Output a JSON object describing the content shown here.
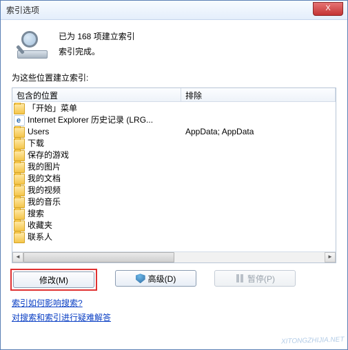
{
  "window": {
    "title": "索引选项",
    "close_label": "X"
  },
  "status": {
    "line1": "已为 168 项建立索引",
    "line2": "索引完成。"
  },
  "section_label": "为这些位置建立索引:",
  "columns": {
    "included": "包含的位置",
    "excluded": "排除"
  },
  "rows": [
    {
      "icon": "folder",
      "name": "「开始」菜单",
      "exclude": ""
    },
    {
      "icon": "ie",
      "name": "Internet Explorer 历史记录 (LRG...",
      "exclude": ""
    },
    {
      "icon": "folder",
      "name": "Users",
      "exclude": "AppData; AppData"
    },
    {
      "icon": "folder",
      "name": "下载",
      "exclude": ""
    },
    {
      "icon": "folder",
      "name": "保存的游戏",
      "exclude": ""
    },
    {
      "icon": "folder",
      "name": "我的图片",
      "exclude": ""
    },
    {
      "icon": "folder",
      "name": "我的文档",
      "exclude": ""
    },
    {
      "icon": "folder",
      "name": "我的视频",
      "exclude": ""
    },
    {
      "icon": "folder",
      "name": "我的音乐",
      "exclude": ""
    },
    {
      "icon": "folder",
      "name": "搜索",
      "exclude": ""
    },
    {
      "icon": "folder",
      "name": "收藏夹",
      "exclude": ""
    },
    {
      "icon": "folder",
      "name": "联系人",
      "exclude": ""
    }
  ],
  "buttons": {
    "modify": "修改(M)",
    "advanced": "高级(D)",
    "pause": "暂停(P)"
  },
  "links": {
    "how_affects": "索引如何影响搜索?",
    "troubleshoot": "对搜索和索引进行疑难解答"
  },
  "watermark": "XITONGZHIJIA.NET"
}
